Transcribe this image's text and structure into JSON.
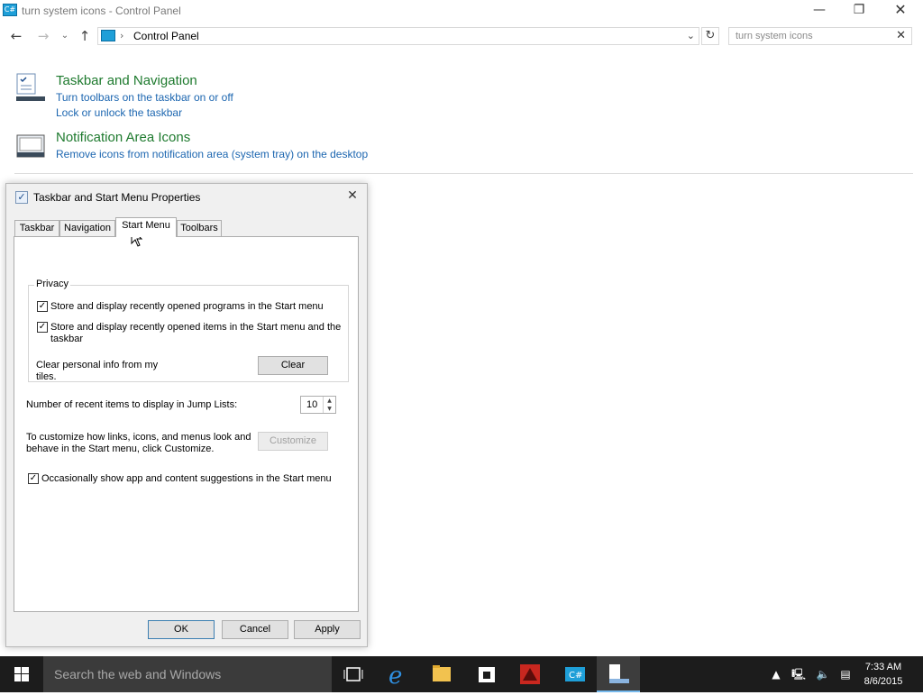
{
  "window": {
    "title": "turn system icons - Control Panel",
    "app_icon_text": "C#"
  },
  "nav": {
    "address_path": "Control Panel",
    "search_value": "turn system icons"
  },
  "results": [
    {
      "heading": "Taskbar and Navigation",
      "links": [
        "Turn toolbars on the taskbar on or off",
        "Lock or unlock the taskbar"
      ]
    },
    {
      "heading": "Notification Area Icons",
      "links": [
        "Remove icons from notification area (system tray) on the desktop"
      ]
    }
  ],
  "dialog": {
    "title": "Taskbar and Start Menu Properties",
    "tabs": [
      "Taskbar",
      "Navigation",
      "Start Menu",
      "Toolbars"
    ],
    "active_tab": "Start Menu",
    "privacy": {
      "legend": "Privacy",
      "opt1": "Store and display recently opened programs in the Start menu",
      "opt2_line1": "Store and display recently opened items in the Start menu and the",
      "opt2_line2": "taskbar",
      "clear_text_line1": "Clear personal info from my",
      "clear_text_line2": "tiles.",
      "clear_button": "Clear"
    },
    "jump_list_label": "Number of recent items to display in Jump Lists:",
    "jump_list_value": "10",
    "customize_text_line1": "To customize how links, icons, and menus look and",
    "customize_text_line2": "behave in the Start menu, click Customize.",
    "customize_button": "Customize",
    "suggestions_label": "Occasionally show app and content suggestions in the Start menu",
    "buttons": {
      "ok": "OK",
      "cancel": "Cancel",
      "apply": "Apply"
    }
  },
  "taskbar": {
    "search_placeholder": "Search the web and Windows",
    "time": "7:33 AM",
    "date": "8/6/2015"
  },
  "colors": {
    "heading_green": "#1e7a2e",
    "link_blue": "#1c66b0",
    "taskbar": "#1c1c1c"
  }
}
